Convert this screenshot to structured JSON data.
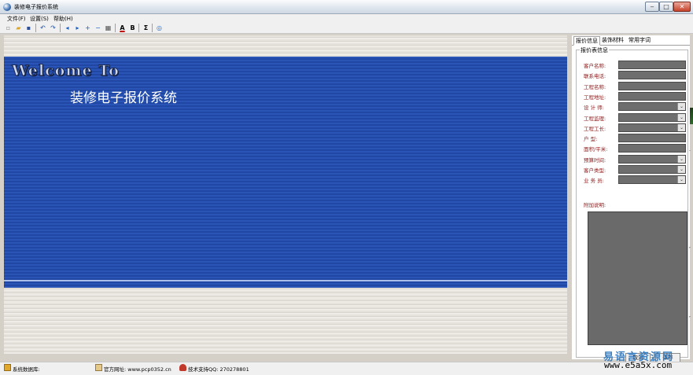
{
  "window": {
    "title": "装修电子报价系统",
    "min": "‒",
    "max": "□",
    "close": "✕"
  },
  "menu": [
    "文件(F)",
    "设置(S)",
    "帮助(H)"
  ],
  "toolbar": {
    "icons": [
      "new-icon",
      "open-icon",
      "save-icon",
      "undo-icon",
      "redo-icon",
      "arrow-left-icon",
      "arrow-right-icon",
      "add-icon",
      "remove-icon",
      "table-icon",
      "font-color-icon",
      "bold-icon",
      "sum-icon",
      "help-icon"
    ],
    "glyphs": {
      "new": "▫",
      "open": "▰",
      "save": "▪",
      "undo": "↶",
      "redo": "↷",
      "left": "◂",
      "right": "▸",
      "add": "+",
      "remove": "−",
      "table": "▦",
      "font": "A",
      "bold": "B",
      "sum": "Σ",
      "help": "◎"
    },
    "font_color": "#c00000"
  },
  "banner": {
    "welcome": "Welcome To",
    "subtitle": "装修电子报价系统"
  },
  "panel": {
    "tabs": [
      "报价信息",
      "装饰材料",
      "常用字词"
    ],
    "group_title": "报价表信息",
    "fields": [
      {
        "label": "客户名称:",
        "type": "text",
        "value": ""
      },
      {
        "label": "联系电话:",
        "type": "text",
        "value": ""
      },
      {
        "label": "工程名称:",
        "type": "text",
        "value": ""
      },
      {
        "label": "工程地址:",
        "type": "text",
        "value": ""
      },
      {
        "label": "设 计 师:",
        "type": "combo",
        "value": ""
      },
      {
        "label": "工程监理:",
        "type": "combo",
        "value": ""
      },
      {
        "label": "工程工长:",
        "type": "combo",
        "value": ""
      },
      {
        "label": "户    型:",
        "type": "text",
        "value": ""
      },
      {
        "label": "面积/平米:",
        "type": "text",
        "value": ""
      },
      {
        "label": "预算时间:",
        "type": "combo",
        "value": ""
      },
      {
        "label": "客户类型:",
        "type": "combo",
        "value": ""
      },
      {
        "label": "业 务 员:",
        "type": "combo",
        "value": ""
      }
    ],
    "notes_label": "附加说明:",
    "notes_value": "",
    "cancel": "取消",
    "save": "保存"
  },
  "status": {
    "database": "系统数据库:",
    "website": "官方网址: www.pcp0352.cn",
    "support": "技术支持QQ: 270278801"
  },
  "watermark": {
    "name": "易语言资源网",
    "url": "www.e5a5x.com"
  },
  "colors": {
    "banner": "#2a55b6",
    "label": "#8b1a1a",
    "field": "#6e6e6e",
    "watermark": "#3a7fc2"
  }
}
